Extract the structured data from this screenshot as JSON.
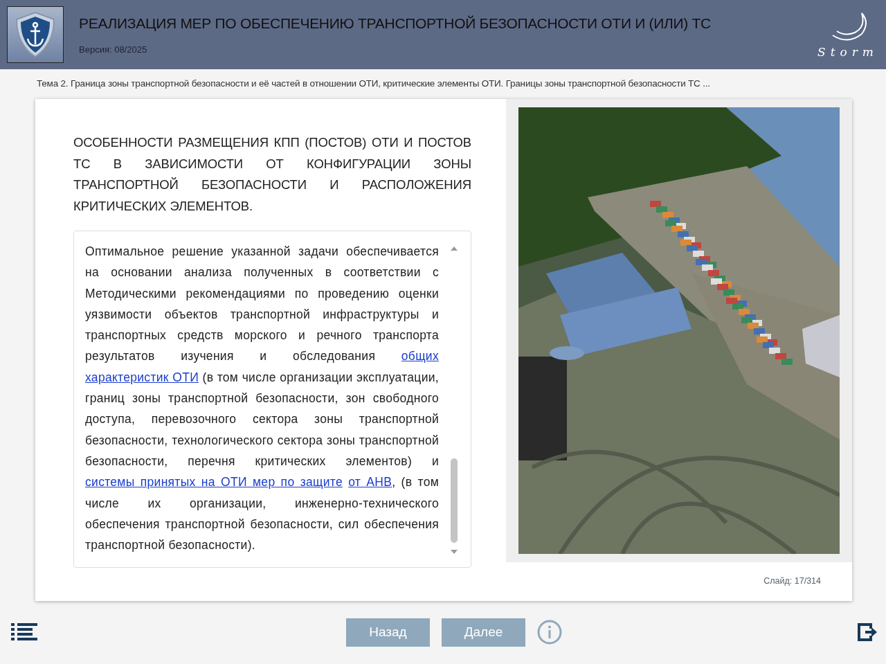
{
  "header": {
    "title": "РЕАЛИЗАЦИЯ МЕР ПО ОБЕСПЕЧЕНИЮ ТРАНСПОРТНОЙ БЕЗОПАСНОСТИ ОТИ И (ИЛИ) ТС",
    "version": "Версия: 08/2025",
    "logo_text": "Storm"
  },
  "topic": "Тема 2. Граница зоны транспортной безопасности и её частей в отношении ОТИ, критические элементы ОТИ. Границы зоны транспортной безопасности ТС ...",
  "slide": {
    "heading": "ОСОБЕННОСТИ РАЗМЕЩЕНИЯ КПП (ПОСТОВ) ОТИ И ПОСТОВ ТС В ЗАВИСИМОСТИ ОТ КОНФИГУРАЦИИ ЗОНЫ ТРАНСПОРТНОЙ БЕЗОПАСНОСТИ И РАСПОЛОЖЕНИЯ КРИТИЧЕСКИХ ЭЛЕМЕНТОВ.",
    "body": [
      {
        "kind": "text",
        "text": "Оптимальное решение указанной задачи обеспечивается на основании анализа полученных в соответствии с Методическими рекомендациями по проведению оценки уязвимости объектов транспортной инфраструктуры и транспортных средств морского и речного транспорта результатов изучения и обследования "
      },
      {
        "kind": "link",
        "parts": [
          "общих",
          "характеристик ОТИ"
        ]
      },
      {
        "kind": "text",
        "text": " (в том числе организации эксплуатации, границ зоны транспортной безопасности, зон свободного доступа, перевозочного сектора зоны транспортной безопасности, технологического сектора зоны транспортной безопасности, перечня критических элементов) и "
      },
      {
        "kind": "link",
        "parts": [
          "системы принятых на ОТИ мер по защите",
          "от АНВ"
        ]
      },
      {
        "kind": "text",
        "text": ", (в том числе их организации, инженерно-технического обеспечения транспортной безопасности, сил обеспечения транспортной безопасности)."
      }
    ],
    "counter": "Слайд: 17/314"
  },
  "nav": {
    "back": "Назад",
    "next": "Далее"
  }
}
